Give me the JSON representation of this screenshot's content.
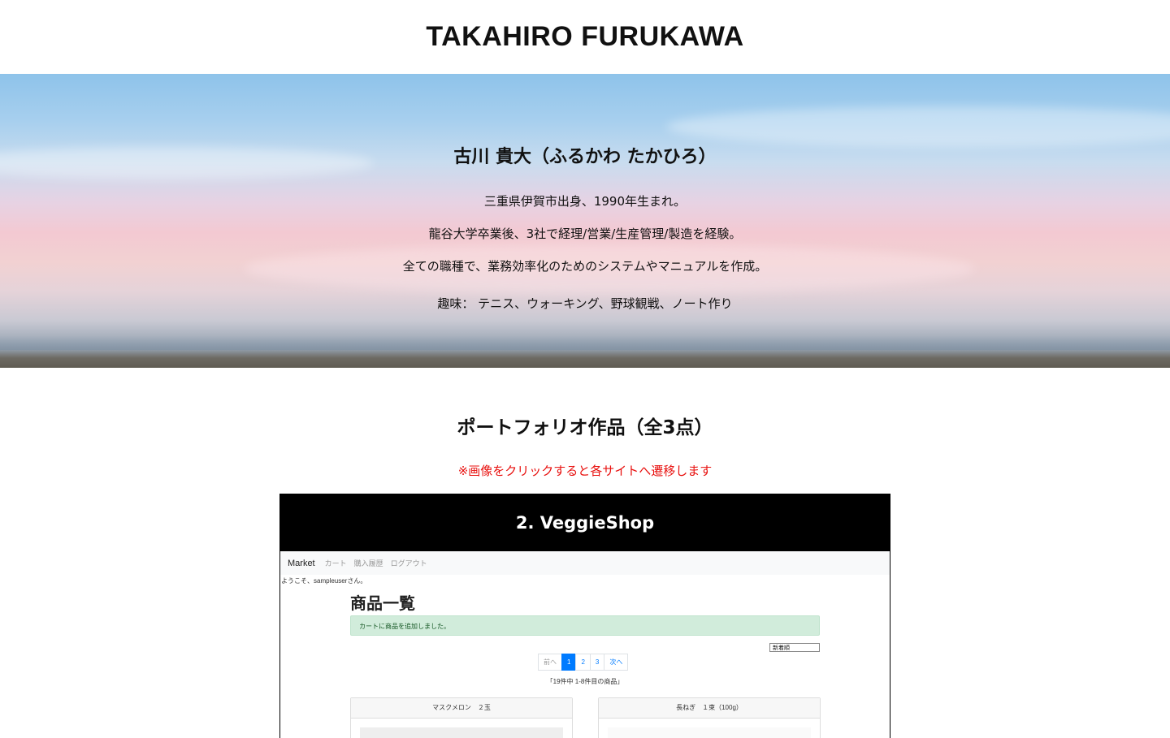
{
  "header": {
    "title": "TAKAHIRO FURUKAWA"
  },
  "hero": {
    "name": "古川 貴大（ふるかわ たかひろ）",
    "lines": [
      "三重県伊賀市出身、1990年生まれ。",
      "龍谷大学卒業後、3社で経理/営業/生産管理/製造を経験。",
      "全ての職種で、業務効率化のためのシステムやマニュアルを作成。"
    ],
    "hobby": "趣味： テニス、ウォーキング、野球観戦、ノート作り"
  },
  "portfolio": {
    "title": "ポートフォリオ作品（全3点）",
    "note": "※画像をクリックすると各サイトへ遷移します",
    "note_color": "#e8110f",
    "work": {
      "title": "2. VeggieShop",
      "screenshot": {
        "brand": "Market",
        "nav": [
          "カート",
          "購入履歴",
          "ログアウト"
        ],
        "welcome": "ようこそ、sampleuserさん。",
        "heading": "商品一覧",
        "alert": "カートに商品を追加しました。",
        "sort": "新着順",
        "pager": [
          "前へ",
          "1",
          "2",
          "3",
          "次へ"
        ],
        "count": "「19件中 1-8件目の商品」",
        "items": [
          "マスクメロン　２玉",
          "長ねぎ　１束（100g）"
        ]
      }
    }
  }
}
